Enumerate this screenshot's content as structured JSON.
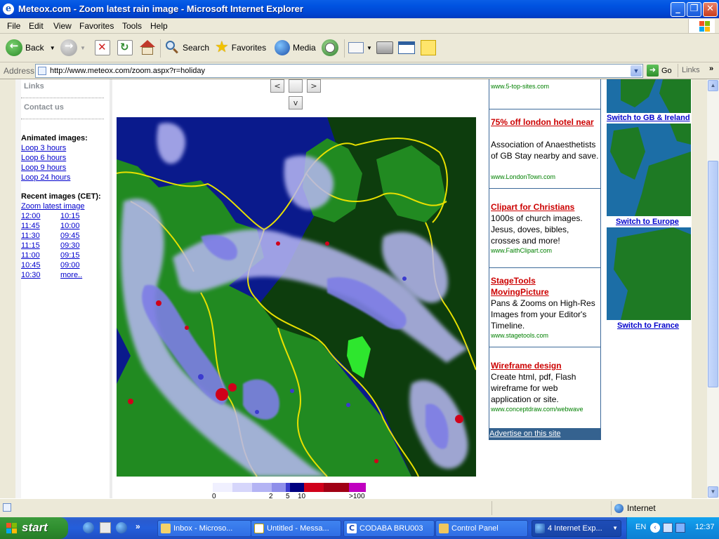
{
  "window": {
    "title": "Meteox.com - Zoom latest rain image - Microsoft Internet Explorer",
    "min_glyph": "_",
    "max_glyph": "❐",
    "close_glyph": "✕"
  },
  "menu": [
    "File",
    "Edit",
    "View",
    "Favorites",
    "Tools",
    "Help"
  ],
  "toolbar": {
    "back": "Back",
    "search": "Search",
    "favorites": "Favorites",
    "media": "Media"
  },
  "address": {
    "label": "Address",
    "url": "http://www.meteox.com/zoom.aspx?r=holiday",
    "go": "Go",
    "links": "Links"
  },
  "nav": {
    "links": "Links",
    "contact": "Contact us",
    "animated_title": "Animated images:",
    "animated": [
      "Loop 3 hours",
      "Loop 6 hours",
      "Loop 9 hours",
      "Loop 24 hours"
    ],
    "recent_title": "Recent images (CET):",
    "zoom_latest": "Zoom latest image",
    "times_left": [
      "12:00",
      "11:45",
      "11:30",
      "11:15",
      "11:00",
      "10:45",
      "10:30"
    ],
    "times_right": [
      "10:15",
      "10:00",
      "09:45",
      "09:30",
      "09:15",
      "09:00",
      "more.."
    ]
  },
  "pan": {
    "left": "<",
    "right": ">",
    "down": "v",
    "up": ""
  },
  "legend": {
    "labels": [
      "0",
      "2",
      "5",
      "10",
      ">100"
    ],
    "colors": [
      "#f0f0ff",
      "#d6d6fb",
      "#b4b4f4",
      "#8f8fea",
      "#3b3bcf",
      "#000080",
      "#d0001a",
      "#a00014",
      "#c000c0"
    ]
  },
  "ads": [
    {
      "title": "",
      "desc": "",
      "url": "www.5-top-sites.com"
    },
    {
      "title": "75% off london hotel near",
      "desc": "Association of Anaesthetists of GB Stay nearby and save.",
      "url": "www.LondonTown.com"
    },
    {
      "title": "Clipart for Christians",
      "desc": "1000s of church images. Jesus, doves, bibles, crosses and more!",
      "url": "www.FaithClipart.com"
    },
    {
      "title": "StageTools MovingPicture",
      "desc": "Pans & Zooms on High-Res Images from your Editor's Timeline.",
      "url": "www.stagetools.com"
    },
    {
      "title": "Wireframe design",
      "desc": "Create html, pdf, Flash wireframe for web application or site.",
      "url": "www.conceptdraw.com/webwave"
    }
  ],
  "advertise": "Advertise on this site",
  "maps": [
    "Switch to GB & Ireland",
    "Switch to Europe",
    "Switch to France"
  ],
  "status": {
    "zone": "Internet"
  },
  "taskbar": {
    "start": "start",
    "tasks": [
      "Inbox - Microso...",
      "Untitled - Messa...",
      "CODABA BRU003",
      "Control Panel",
      "4 Internet Exp..."
    ],
    "lang": "EN",
    "time": "12:37"
  },
  "colors": {
    "sea": "#0a1a8c",
    "land": "#218a21",
    "dark_land": "#0d3d0d",
    "border": "#e8e000",
    "ad_title": "#cc0000",
    "link": "#0000cc"
  }
}
